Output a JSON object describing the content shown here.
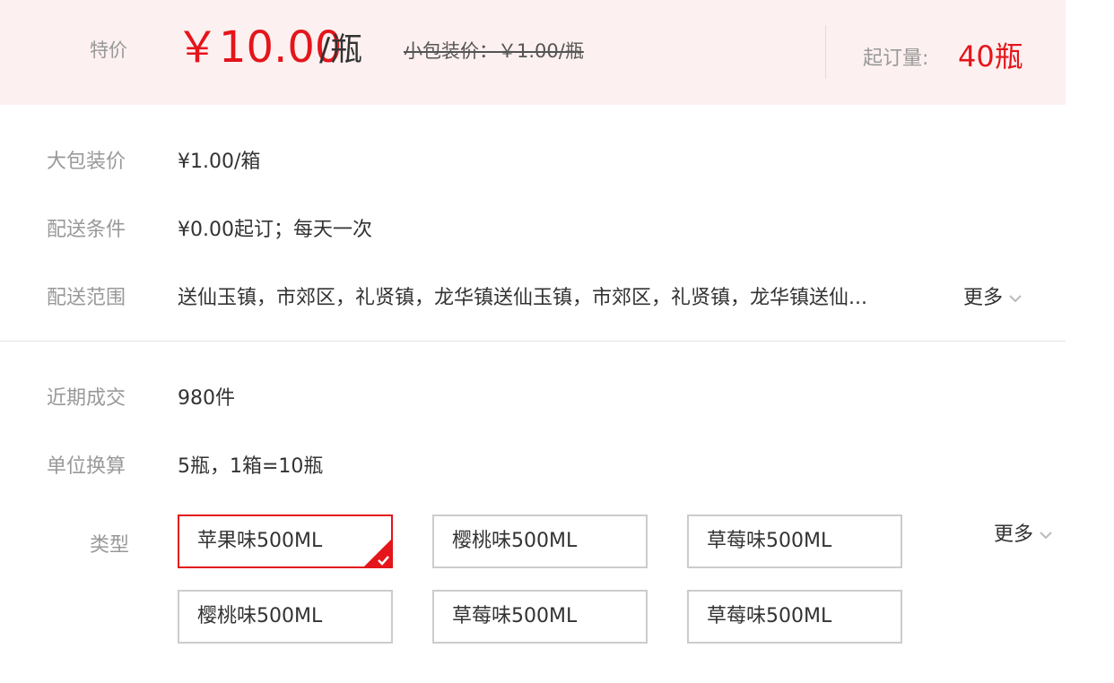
{
  "banner": {
    "label": "特价",
    "price": "￥10.00",
    "unit": "/瓶",
    "small_pack_price": "小包装价：￥1.00/瓶",
    "moq_label": "起订量:",
    "moq_value": "40瓶",
    "accent_color": "#e4151b"
  },
  "details": {
    "big_pack": {
      "label": "大包装价",
      "value": "¥1.00/箱"
    },
    "delivery_terms": {
      "label": "配送条件",
      "value": "¥0.00起订；每天一次"
    },
    "delivery_area": {
      "label": "配送范围",
      "value": "送仙玉镇，市郊区，礼贤镇，龙华镇送仙玉镇，市郊区，礼贤镇，龙华镇送仙...",
      "more_label": "更多",
      "more_icon": "chevron-down-icon"
    },
    "recent_sales": {
      "label": "近期成交",
      "value": "980件"
    },
    "unit_conversion": {
      "label": "单位换算",
      "value": "5瓶，1箱=10瓶"
    }
  },
  "variants": {
    "label": "类型",
    "more_label": "更多",
    "more_icon": "chevron-down-icon",
    "selected_icon": "checkmark-icon",
    "items": [
      {
        "label": "苹果味500ML",
        "selected": true
      },
      {
        "label": "樱桃味500ML",
        "selected": false
      },
      {
        "label": "草莓味500ML",
        "selected": false
      },
      {
        "label": "樱桃味500ML",
        "selected": false
      },
      {
        "label": "草莓味500ML",
        "selected": false
      },
      {
        "label": "草莓味500ML",
        "selected": false
      }
    ]
  }
}
